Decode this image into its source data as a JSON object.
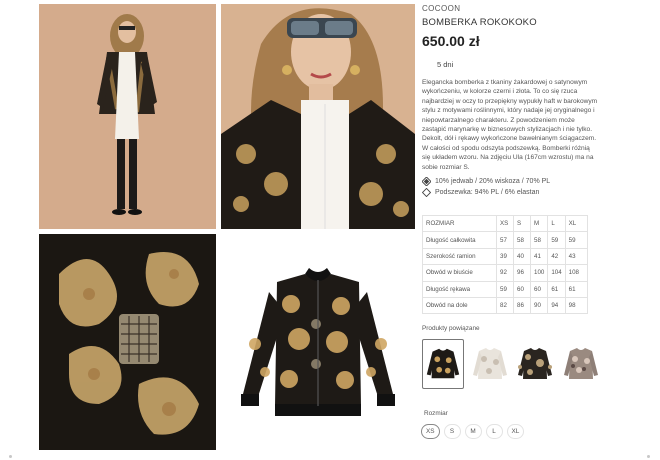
{
  "product": {
    "brand": "COCOON",
    "name": "BOMBERKA ROKOKOKO",
    "price": "650.00 zł",
    "shipping": "5 dni",
    "description": "Elegancka bomberka z tkaniny żakardowej o satynowym wykończeniu, w kolorze czerni i złota. To co się rzuca najbardziej w oczy to przepiękny wypukły haft w barokowym stylu z motywami roślinnymi, który nadaje jej oryginalnego i niepowtarzalnego charakteru. Z powodzeniem może zastąpić marynarkę w biznesowych stylizacjach i nie tylko. Dekolt, dół i rękawy wykończone bawełnianym ściągaczem. W całości od spodu odszyta podszewką. Bomberki różnią się układem wzoru. Na zdjęciu Ula (167cm wzrostu) ma na sobie rozmiar S.",
    "materials": [
      {
        "icon": "fabric-diamond-icon",
        "text": "10% jedwab / 20% wiskoza / 70% PL"
      },
      {
        "icon": "lining-diamond-icon",
        "text": "Podszewka: 94% PL / 6% elastan"
      }
    ]
  },
  "gallery": {
    "photos": [
      {
        "name": "model-full-body-photo"
      },
      {
        "name": "model-closeup-photo"
      },
      {
        "name": "fabric-detail-photo"
      },
      {
        "name": "jacket-flatlay-photo"
      }
    ]
  },
  "size_table": {
    "header": [
      "ROZMIAR",
      "XS",
      "S",
      "M",
      "L",
      "XL"
    ],
    "rows": [
      [
        "Długość całkowita",
        "57",
        "58",
        "58",
        "59",
        "59"
      ],
      [
        "Szerokość ramion",
        "39",
        "40",
        "41",
        "42",
        "43"
      ],
      [
        "Obwód w biuście",
        "92",
        "96",
        "100",
        "104",
        "108"
      ],
      [
        "Długość rękawa",
        "59",
        "60",
        "60",
        "61",
        "61"
      ],
      [
        "Obwód na dole",
        "82",
        "86",
        "90",
        "94",
        "98"
      ]
    ]
  },
  "related": {
    "title": "Produkty powiązane",
    "items": [
      {
        "name": "related-black-gold-bomber",
        "selected": true
      },
      {
        "name": "related-white-bomber",
        "selected": false
      },
      {
        "name": "related-camo-bomber",
        "selected": false
      },
      {
        "name": "related-floral-bomber",
        "selected": false
      }
    ]
  },
  "size_picker": {
    "title": "Rozmiar",
    "options": [
      "XS",
      "S",
      "M",
      "L",
      "XL"
    ],
    "selected": "XS"
  },
  "colors": {
    "beige_bg": "#d7b08f",
    "jacket_black": "#1e1a16",
    "gold": "#c9a15e",
    "border": "#e2e2e2"
  }
}
